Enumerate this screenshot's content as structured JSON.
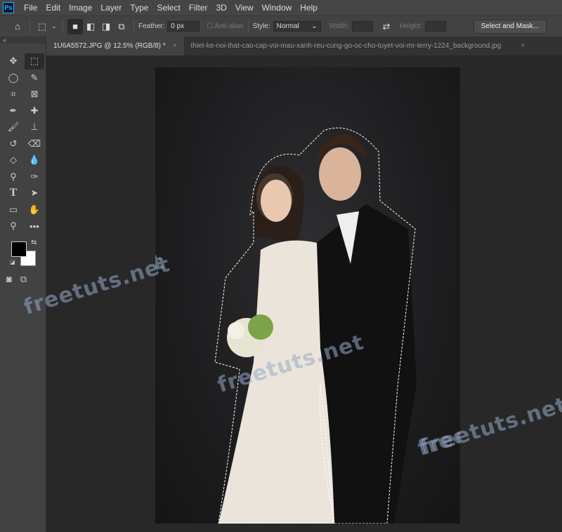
{
  "menubar": {
    "logo": "Ps",
    "items": [
      "File",
      "Edit",
      "Image",
      "Layer",
      "Type",
      "Select",
      "Filter",
      "3D",
      "View",
      "Window",
      "Help"
    ]
  },
  "options": {
    "feather_label": "Feather:",
    "feather_value": "0 px",
    "antialias_label": "Anti-alias",
    "style_label": "Style:",
    "style_value": "Normal",
    "width_label": "Width:",
    "height_label": "Height:",
    "select_mask_label": "Select and Mask..."
  },
  "tabs": [
    {
      "label": "1U6A5572.JPG @ 12.5% (RGB/8) *",
      "active": true
    },
    {
      "label": "thiet-ke-noi-that-cao-cap-voi-mau-xanh-reu-cung-go-oc-cho-tuyet-voi-mr-terry-1224_background.jpg",
      "active": false
    }
  ],
  "tools": [
    "move-icon",
    "rect-marquee-icon",
    "lasso-icon",
    "quick-select-icon",
    "crop-icon",
    "frame-icon",
    "eyedropper-icon",
    "healing-icon",
    "brush-icon",
    "stamp-icon",
    "history-brush-icon",
    "eraser-icon",
    "paint-bucket-icon",
    "blur-icon",
    "dodge-icon",
    "pen-icon",
    "type-icon",
    "path-select-icon",
    "rectangle-icon",
    "hand-icon",
    "zoom-icon",
    "more-icon"
  ],
  "colors": {
    "foreground": "#000000",
    "background": "#ffffff"
  },
  "watermark": "freetuts.net"
}
